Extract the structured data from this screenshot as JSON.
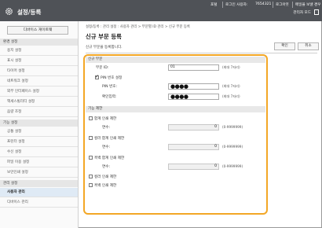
{
  "header": {
    "title": "설정/등록",
    "links": [
      "포털",
      "로그인 사용자:",
      "7654321",
      "로그아웃",
      "메일을 보낼 경우"
    ],
    "admin_mode": "관리자 모드"
  },
  "sidebar": {
    "portal_button": "디바이스 게이트웨",
    "sections": [
      {
        "head": "환경 설정",
        "items": [
          "용지 설정",
          "표시 설정",
          "타이머 설정",
          "네트워크 설정",
          "외부 인터페이스 설정",
          "액세스빌리티 설정",
          "음량 조정"
        ]
      },
      {
        "head": "기능 설정",
        "items": [
          "공통 설정",
          "프린터 설정",
          "수신 설정",
          "파일 이용 설정",
          "보안인쇄 설정"
        ]
      },
      {
        "head": "관리 설정",
        "items": [
          "사용자 관리",
          "디바이스 관리"
        ]
      }
    ],
    "active_item": "사용자 관리"
  },
  "main": {
    "breadcrumb": "설정/등록 : 관리 설정 : 사용자 관리 > 부문별 ID 관리 > 신규 부문 등록",
    "page_title": "신규 부문 등록",
    "subtitle": "신규 부문을 등록합니다.",
    "ok_button": "확인",
    "cancel_button": "취소",
    "section_new": {
      "head": "신규 부문",
      "dept_id_label": "부문 ID:",
      "dept_id_value": "01",
      "dept_id_hint": "(최대 7자리)",
      "pin_checkbox_label": "PIN 번호 설정",
      "pin_checked": true,
      "pin_label": "PIN 번호:",
      "pin_value": "●●●●",
      "pin_hint": "(최대 7자리)",
      "confirm_label": "확인입력:",
      "confirm_value": "●●●●",
      "confirm_hint": "(최대 7자리)"
    },
    "section_func": {
      "head": "기능 제한",
      "rows": [
        {
          "checkbox_label": "합계 인쇄 제한",
          "count_label": "면수:",
          "value": "0",
          "hint": "(0-9999999)"
        },
        {
          "checkbox_label": "컬러 합계 인쇄 제한",
          "count_label": "면수:",
          "value": "0",
          "hint": "(0-9999999)"
        },
        {
          "checkbox_label": "흑백 합계 인쇄 제한",
          "count_label": "면수:",
          "value": "0",
          "hint": "(0-9999999)"
        }
      ],
      "extra_checkboxes": [
        "컬러 인쇄 제한",
        "흑백 인쇄 제한"
      ]
    }
  },
  "colors": {
    "header_bg": "#4f5257",
    "highlight": "#f3a726",
    "active_item_bg": "#dfeaf5"
  },
  "icons": {
    "header": "gear-icon"
  }
}
